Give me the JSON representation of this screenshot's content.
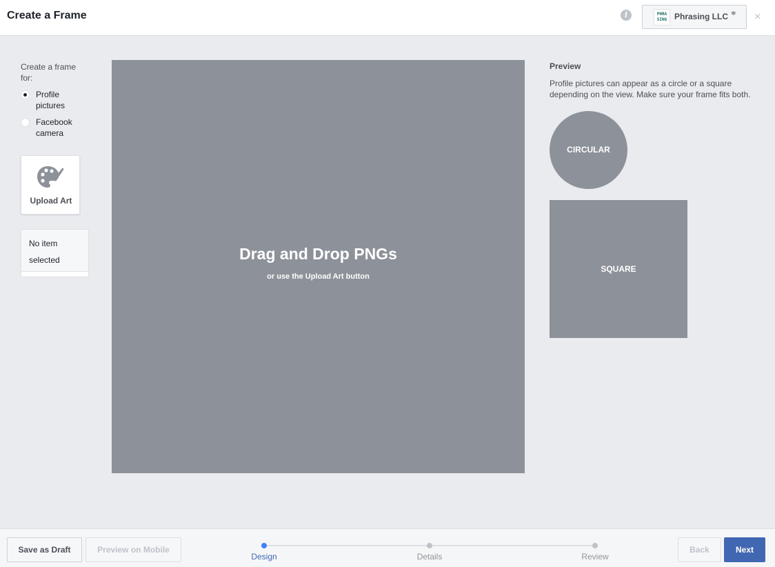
{
  "header": {
    "title": "Create a Frame",
    "info_icon": "i",
    "page_logo_text": "PHRA SING",
    "page_name": "Phrasing LLC",
    "page_caret": "≑",
    "close_icon": "×"
  },
  "left_panel": {
    "frame_for_label": "Create a frame for:",
    "options": [
      {
        "label": "Profile pictures",
        "checked": true
      },
      {
        "label": "Facebook camera",
        "checked": false
      }
    ],
    "upload_art_label": "Upload Art",
    "no_item_label": "No item selected"
  },
  "canvas": {
    "title": "Drag and Drop PNGs",
    "subtitle": "or use the Upload Art button"
  },
  "preview": {
    "title": "Preview",
    "description": "Profile pictures can appear as a circle or a square depending on the view. Make sure your frame fits both.",
    "circular_label": "CIRCULAR",
    "square_label": "SQUARE"
  },
  "footer": {
    "save_draft_label": "Save as Draft",
    "preview_mobile_label": "Preview on Mobile",
    "steps": [
      {
        "label": "Design",
        "active": true
      },
      {
        "label": "Details",
        "active": false
      },
      {
        "label": "Review",
        "active": false
      }
    ],
    "back_label": "Back",
    "next_label": "Next"
  },
  "colors": {
    "accent": "#4267b2",
    "active_step": "#4080ff",
    "placeholder_gray": "#8d9199",
    "background": "#e9ebee"
  }
}
